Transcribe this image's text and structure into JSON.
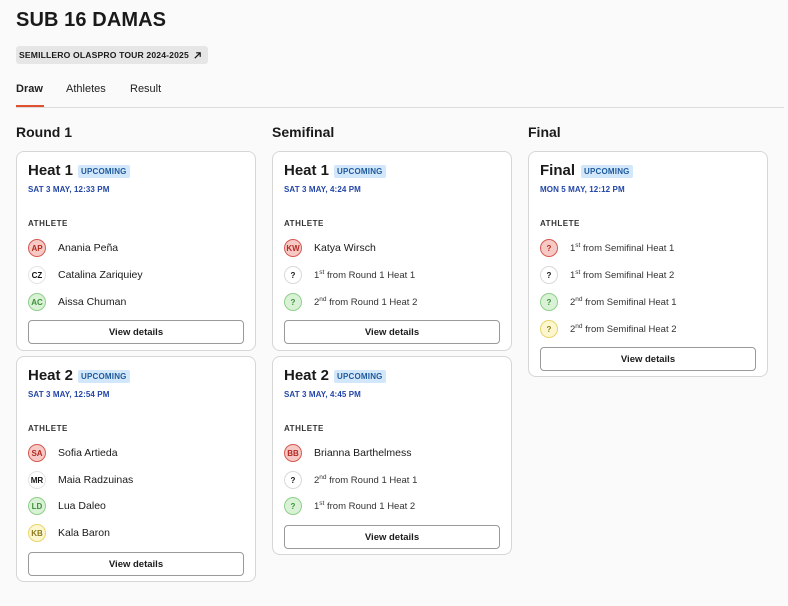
{
  "page": {
    "title": "SUB 16 DAMAS",
    "tour_label": "SEMILLERO OLASPRO TOUR 2024-2025",
    "tour_icon": "external-link-icon"
  },
  "tabs": [
    {
      "label": "Draw",
      "active": true
    },
    {
      "label": "Athletes",
      "active": false
    },
    {
      "label": "Result",
      "active": false
    }
  ],
  "common": {
    "athlete_header": "ATHLETE",
    "view_details": "View details",
    "status": "UPCOMING"
  },
  "columns": [
    {
      "title": "Round 1",
      "heats": [
        {
          "title": "Heat 1",
          "status": "UPCOMING",
          "date": "SAT 3 MAY, 12:33 PM",
          "athletes": [
            {
              "initials": "AP",
              "name": "Anania Peña",
              "color": "red"
            },
            {
              "initials": "CZ",
              "name": "Catalina Zariquiey",
              "color": "white"
            },
            {
              "initials": "AC",
              "name": "Aissa Chuman",
              "color": "green"
            }
          ]
        },
        {
          "title": "Heat 2",
          "status": "UPCOMING",
          "date": "SAT 3 MAY, 12:54 PM",
          "athletes": [
            {
              "initials": "SA",
              "name": "Sofia Artieda",
              "color": "red"
            },
            {
              "initials": "MR",
              "name": "Maia Radzuinas",
              "color": "white"
            },
            {
              "initials": "LD",
              "name": "Lua Daleo",
              "color": "green"
            },
            {
              "initials": "KB",
              "name": "Kala Baron",
              "color": "yellow"
            }
          ]
        }
      ]
    },
    {
      "title": "Semifinal",
      "heats": [
        {
          "title": "Heat 1",
          "status": "UPCOMING",
          "date": "SAT 3 MAY, 4:24 PM",
          "athletes": [
            {
              "initials": "KW",
              "name": "Katya Wirsch",
              "color": "red"
            },
            {
              "initials": "?",
              "rank": "1",
              "suffix": "st",
              "source": " from Round 1 Heat 1",
              "color": "q-white"
            },
            {
              "initials": "?",
              "rank": "2",
              "suffix": "nd",
              "source": " from Round 1 Heat 2",
              "color": "q-green"
            }
          ]
        },
        {
          "title": "Heat 2",
          "status": "UPCOMING",
          "date": "SAT 3 MAY, 4:45 PM",
          "athletes": [
            {
              "initials": "BB",
              "name": "Brianna Barthelmess",
              "color": "red"
            },
            {
              "initials": "?",
              "rank": "2",
              "suffix": "nd",
              "source": " from Round 1 Heat 1",
              "color": "q-white"
            },
            {
              "initials": "?",
              "rank": "1",
              "suffix": "st",
              "source": " from Round 1 Heat 2",
              "color": "q-green"
            }
          ]
        }
      ]
    },
    {
      "title": "Final",
      "heats": [
        {
          "title": "Final",
          "status": "UPCOMING",
          "date": "MON 5 MAY, 12:12 PM",
          "athletes": [
            {
              "initials": "?",
              "rank": "1",
              "suffix": "st",
              "source": " from Semifinal Heat 1",
              "color": "q-red"
            },
            {
              "initials": "?",
              "rank": "1",
              "suffix": "st",
              "source": " from Semifinal Heat 2",
              "color": "q-white"
            },
            {
              "initials": "?",
              "rank": "2",
              "suffix": "nd",
              "source": " from Semifinal Heat 1",
              "color": "q-green"
            },
            {
              "initials": "?",
              "rank": "2",
              "suffix": "nd",
              "source": " from Semifinal Heat 2",
              "color": "q-yellow"
            }
          ]
        }
      ]
    }
  ],
  "colors": {
    "accent_tab": "#e0502e",
    "date_blue": "#2246a8",
    "badge_bg": "#d3e7fb",
    "badge_text": "#1e5a9c"
  }
}
